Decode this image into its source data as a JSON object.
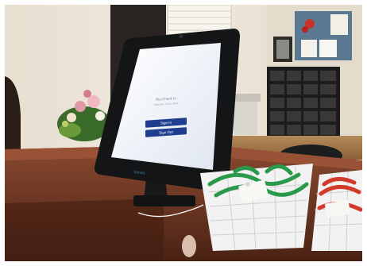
{
  "image": {
    "kind": "photograph",
    "colors": {
      "wall": "#ece6da",
      "desk_wood": "#5a2c1c",
      "desk_top": "#7a3e28",
      "kiosk_frame": "#141517",
      "screen": "#f4f7fb",
      "button": "#1f3f8e",
      "lanyard_green": "#2a9a4a",
      "lanyard_red": "#d23a2a",
      "basket": "#f3f3f3"
    }
  },
  "kiosk": {
    "screen_heading": "Ria Check In",
    "screen_subheading": "Welcome to the office",
    "buttons": [
      {
        "label": "Sign In"
      },
      {
        "label": "Sign Out"
      }
    ],
    "stand_logo": "Vanda"
  }
}
